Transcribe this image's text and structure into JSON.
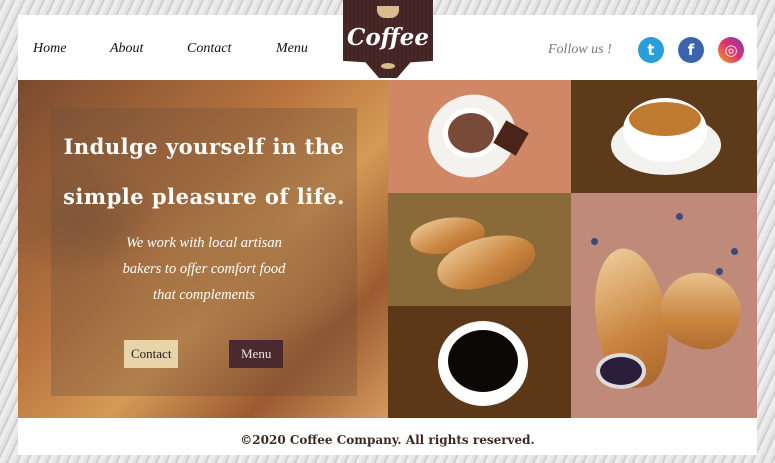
{
  "nav": {
    "items": [
      "Home",
      "About",
      "Contact",
      "Menu"
    ]
  },
  "logo": {
    "text": "Coffee"
  },
  "social": {
    "follow_label": "Follow us !",
    "icons": [
      "twitter-icon",
      "facebook-icon",
      "instagram-icon"
    ]
  },
  "hero": {
    "title_line1": "Indulge yourself in the",
    "title_line2": "simple pleasure of life.",
    "subtitle": [
      "We work with local artisan",
      "bakers to offer comfort food",
      "that complements"
    ],
    "contact_button": "Contact",
    "menu_button": "Menu"
  },
  "colors": {
    "brand": "#4a2a28",
    "accent": "#e9d3a8",
    "tile_salmon": "#d08766",
    "tile_dark": "#5c3a1a",
    "tile_olive": "#8b6a3a",
    "tile_mauve": "#c08a7a"
  },
  "footer": {
    "text": "©2020 Coffee Company. All rights reserved."
  }
}
